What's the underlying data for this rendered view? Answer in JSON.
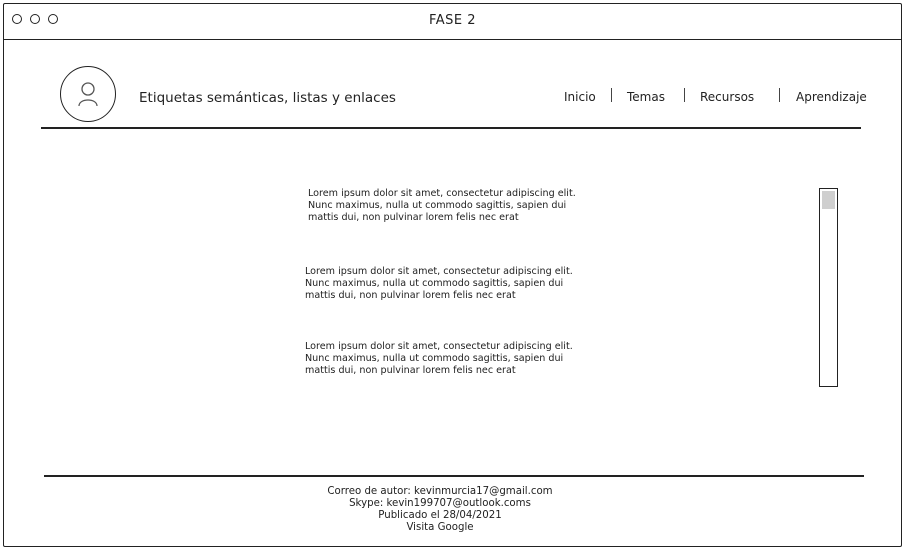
{
  "window": {
    "title": "FASE 2"
  },
  "header": {
    "site_title": "Etiquetas semánticas, listas y enlaces",
    "nav": [
      "Inicio",
      "Temas",
      "Recursos",
      "Aprendizaje"
    ]
  },
  "main": {
    "paragraphs": [
      "Lorem ipsum dolor sit amet, consectetur adipiscing elit. Nunc maximus, nulla ut commodo sagittis, sapien dui mattis dui, non pulvinar lorem felis nec erat",
      "Lorem ipsum dolor sit amet, consectetur adipiscing elit. Nunc maximus, nulla ut commodo sagittis, sapien dui mattis dui, non pulvinar lorem felis nec erat",
      "Lorem ipsum dolor sit amet, consectetur adipiscing elit. Nunc maximus, nulla ut commodo sagittis, sapien dui mattis dui, non pulvinar lorem felis nec erat"
    ]
  },
  "footer": {
    "email": "Correo de autor: kevinmurcia17@gmail.com",
    "skype": "Skype: kevin199707@outlook.coms",
    "published": "Publicado el 28/04/2021",
    "link": "Visita Google"
  },
  "icons": {
    "window_controls": [
      "window-dot-icon",
      "window-dot-icon",
      "window-dot-icon"
    ],
    "avatar": "user-avatar-icon"
  }
}
